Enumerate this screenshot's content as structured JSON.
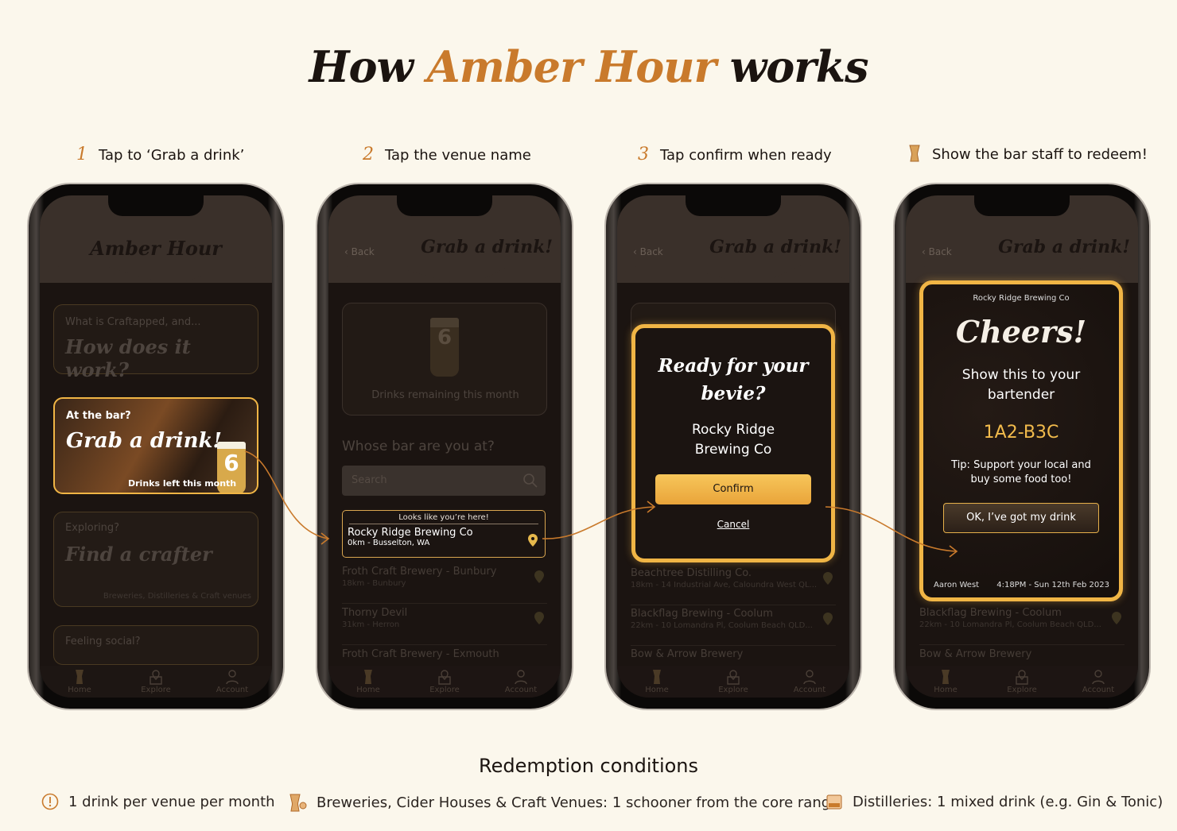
{
  "title": {
    "pre": "How ",
    "brand": "Amber Hour",
    "post": " works"
  },
  "steps": [
    {
      "num": "1",
      "text": "Tap to ‘Grab a drink’"
    },
    {
      "num": "2",
      "text": "Tap the venue name"
    },
    {
      "num": "3",
      "text": "Tap confirm when ready"
    },
    {
      "num": "",
      "icon": "beer-glass-icon",
      "text": "Show the bar staff to redeem!"
    }
  ],
  "colors": {
    "accent": "#c97a2c",
    "gold": "#f0b545",
    "background": "#fbf7ec",
    "screen": "#1b1411"
  },
  "nav": [
    "Home",
    "Explore",
    "Account"
  ],
  "phone1": {
    "app_title": "Amber Hour",
    "card1": {
      "kicker": "What is Craftapped, and...",
      "title": "How does it work?"
    },
    "card2": {
      "kicker": "At the bar?",
      "title": "Grab a drink!",
      "count": "6",
      "caption": "Drinks left this month"
    },
    "card3": {
      "kicker": "Exploring?",
      "title": "Find a crafter",
      "caption": "Breweries, Distilleries & Craft venues"
    },
    "card4": {
      "kicker": "Feeling social?"
    }
  },
  "phone2": {
    "back": "Back",
    "screen_title": "Grab a drink!",
    "drinks": {
      "count": "6",
      "caption": "Drinks remaining this month"
    },
    "question": "Whose bar are you at?",
    "search_placeholder": "Search",
    "here": {
      "label": "Looks like you’re here!",
      "name": "Rocky Ridge Brewing Co",
      "sub": "0km - Busselton, WA"
    },
    "venues": [
      {
        "name": "Froth Craft Brewery - Bunbury",
        "sub": "18km - Bunbury"
      },
      {
        "name": "Thorny Devil",
        "sub": "31km - Herron"
      },
      {
        "name": "Froth Craft Brewery - Exmouth",
        "sub": ""
      }
    ]
  },
  "phone3": {
    "back": "Back",
    "screen_title": "Grab a drink!",
    "modal": {
      "title": "Ready for your bevie?",
      "venue": "Rocky Ridge Brewing Co",
      "confirm": "Confirm",
      "cancel": "Cancel"
    },
    "venues": [
      {
        "name": "Beachtree Distilling Co.",
        "sub": "18km - 14 Industrial Ave, Caloundra West QL..."
      },
      {
        "name": "Blackflag Brewing - Coolum",
        "sub": "22km - 10 Lomandra Pl, Coolum Beach QLD..."
      },
      {
        "name": "Bow & Arrow Brewery",
        "sub": ""
      }
    ]
  },
  "phone4": {
    "back": "Back",
    "screen_title": "Grab a drink!",
    "modal": {
      "venue": "Rocky Ridge Brewing Co",
      "title": "Cheers!",
      "instruction": "Show this to your bartender",
      "code": "1A2-B3C",
      "tip": "Tip: Support your local and buy some food too!",
      "ok": "OK, I’ve got my drink",
      "user": "Aaron West",
      "time": "4:18PM - Sun 12th Feb 2023"
    },
    "venues": [
      {
        "name": "Blackflag Brewing - Coolum",
        "sub": "22km - 10 Lomandra Pl, Coolum Beach QLD..."
      },
      {
        "name": "Bow & Arrow Brewery",
        "sub": ""
      }
    ]
  },
  "conditions": {
    "heading": "Redemption conditions",
    "items": [
      {
        "icon": "alert-circle-icon",
        "text": "1 drink per venue per month"
      },
      {
        "icon": "schooner-icon",
        "text": "Breweries, Cider Houses & Craft Venues: 1 schooner from the core range"
      },
      {
        "icon": "mixed-drink-icon",
        "text": "Distilleries: 1 mixed drink (e.g. Gin & Tonic)"
      }
    ]
  }
}
